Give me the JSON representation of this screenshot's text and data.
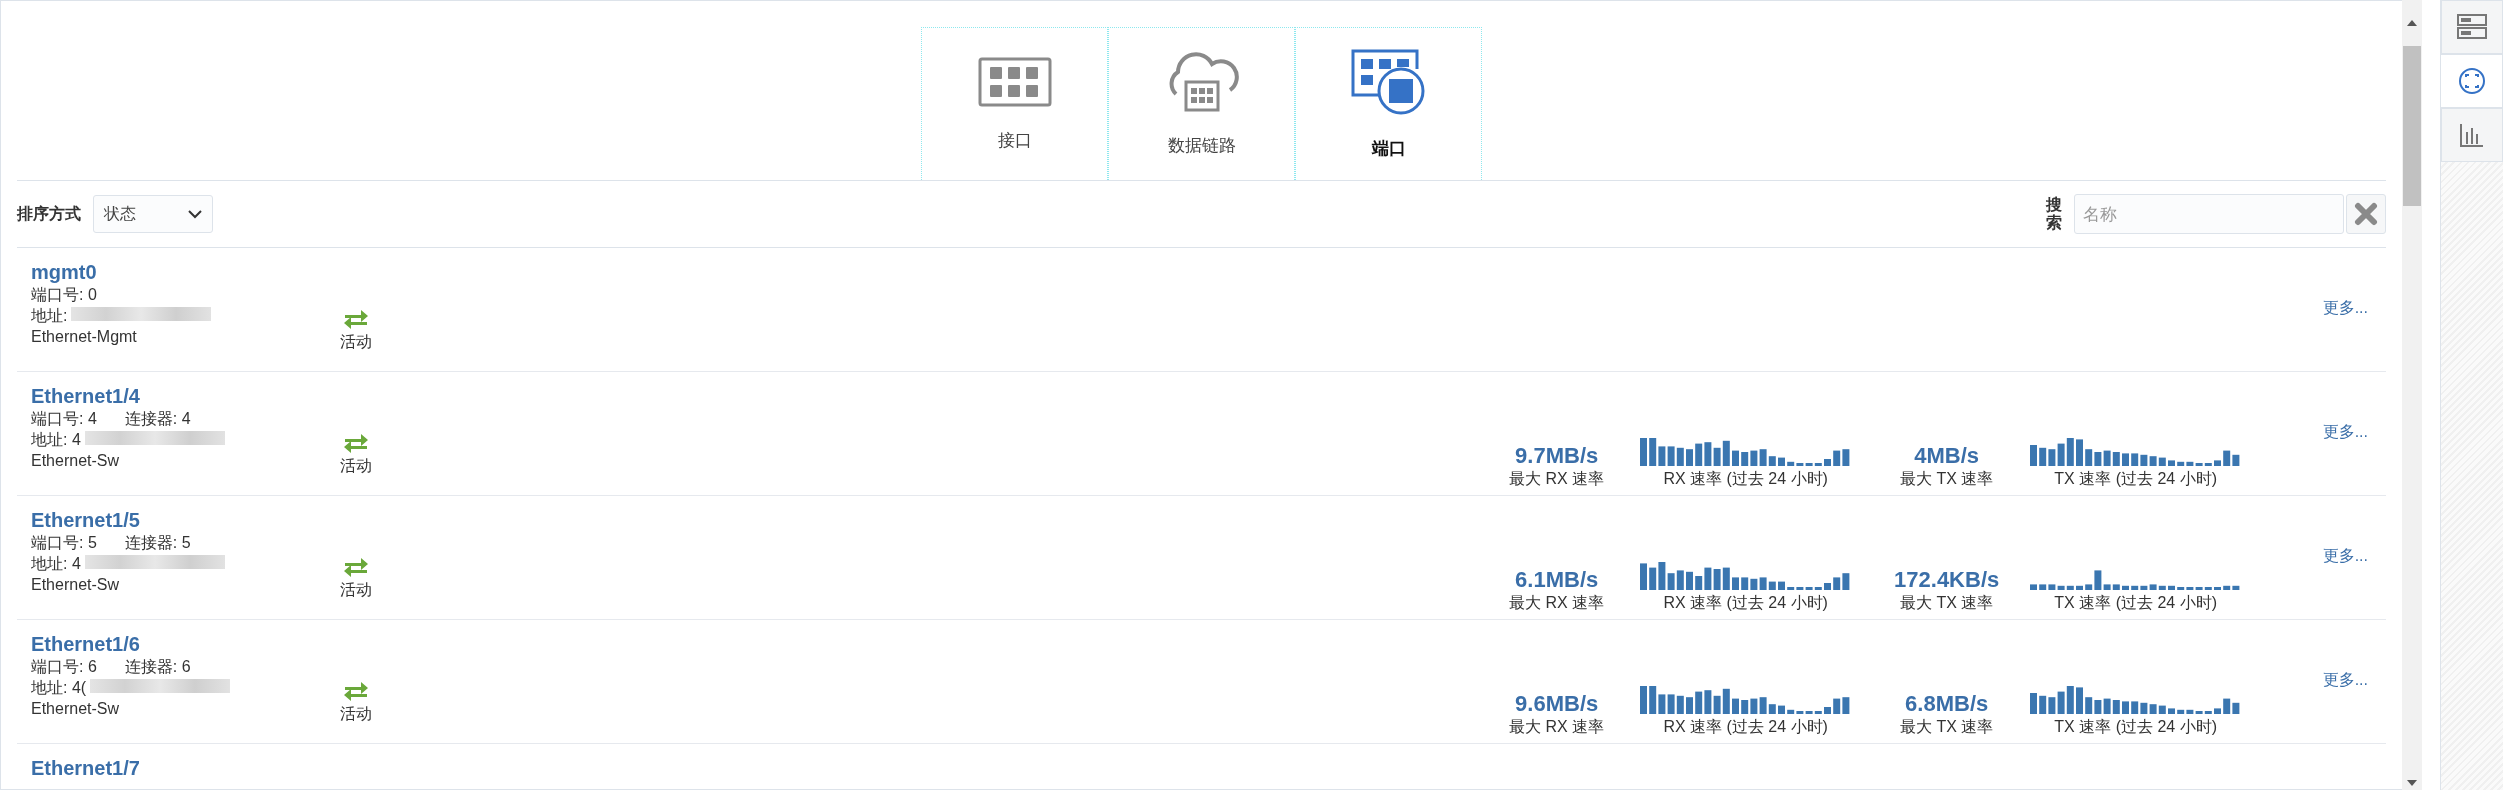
{
  "tabs": [
    {
      "label": "接口",
      "selected": false
    },
    {
      "label": "数据链路",
      "selected": false
    },
    {
      "label": "端口",
      "selected": true
    }
  ],
  "toolbar": {
    "sort_label": "排序方式",
    "sort_value": "状态",
    "search_label": "搜索",
    "search_placeholder": "名称"
  },
  "ports": [
    {
      "name": "mgmt0",
      "port": "端口号: 0",
      "address": "地址:",
      "type": "Ethernet-Mgmt",
      "status": "活动",
      "kind": "active",
      "more": "更多..."
    },
    {
      "name": "Ethernet1/4",
      "port": "端口号: 4",
      "connector": "连接器: 4",
      "address": "地址: 4",
      "type": "Ethernet-Sw",
      "status": "活动",
      "kind": "active",
      "rx_max": "9.7MB/s",
      "rx_max_label": "最大 RX 速率",
      "rx_chart_label": "RX 速率 (过去 24 小时)",
      "tx_max": "4MB/s",
      "tx_max_label": "最大 TX 速率",
      "tx_chart_label": "TX 速率 (过去 24 小时)",
      "more": "更多..."
    },
    {
      "name": "Ethernet1/5",
      "port": "端口号: 5",
      "connector": "连接器: 5",
      "address": "地址: 4",
      "type": "Ethernet-Sw",
      "status": "活动",
      "kind": "active",
      "rx_max": "6.1MB/s",
      "rx_max_label": "最大 RX 速率",
      "rx_chart_label": "RX 速率 (过去 24 小时)",
      "tx_max": "172.4KB/s",
      "tx_max_label": "最大 TX 速率",
      "tx_chart_label": "TX 速率 (过去 24 小时)",
      "more": "更多..."
    },
    {
      "name": "Ethernet1/6",
      "port": "端口号: 6",
      "connector": "连接器: 6",
      "address": "地址: 4(",
      "type": "Ethernet-Sw",
      "status": "活动",
      "kind": "active",
      "rx_max": "9.6MB/s",
      "rx_max_label": "最大 RX 速率",
      "rx_chart_label": "RX 速率 (过去 24 小时)",
      "tx_max": "6.8MB/s",
      "tx_max_label": "最大 TX 速率",
      "tx_chart_label": "TX 速率 (过去 24 小时)",
      "more": "更多..."
    },
    {
      "name": "Ethernet1/7"
    }
  ],
  "sidebar": {
    "items": [
      {
        "selected": false
      },
      {
        "selected": true
      },
      {
        "selected": false
      }
    ]
  }
}
